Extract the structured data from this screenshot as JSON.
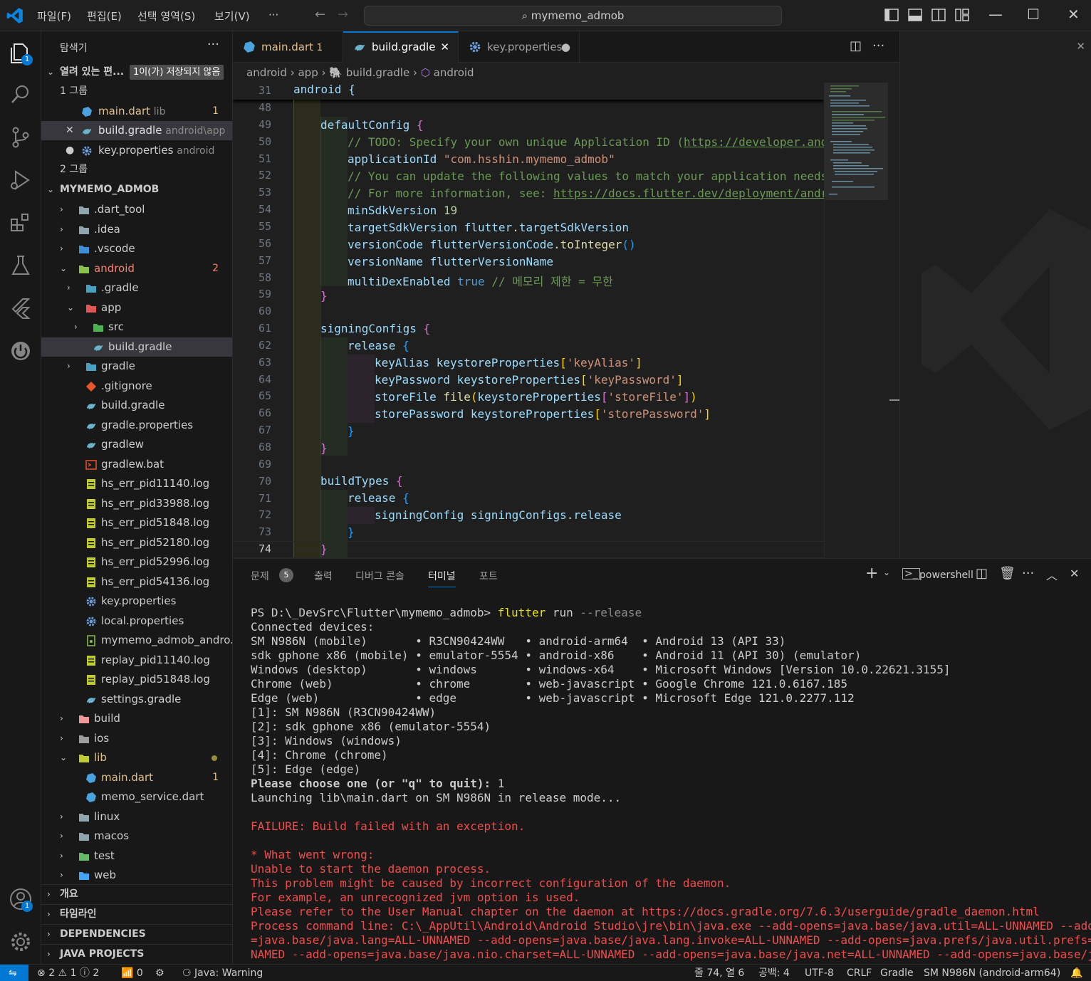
{
  "titlebar": {
    "menus": [
      "파일(F)",
      "편집(E)",
      "선택 영역(S)",
      "보기(V)",
      "···"
    ],
    "search": "mymemo_admob"
  },
  "activity": {
    "explorer_badge": "1",
    "account_badge": "1"
  },
  "sidebar": {
    "title": "탐색기",
    "open_editors_label": "열려 있는 편...",
    "unsaved_badge": "1이(가) 저장되지 않음",
    "group1": "1 그룹",
    "group2": "2 그룹",
    "open_files": [
      {
        "name": "main.dart",
        "desc": "lib",
        "count": "1"
      },
      {
        "name": "build.gradle",
        "desc": "android\\app"
      },
      {
        "name": "key.properties",
        "desc": "android"
      }
    ],
    "project": "MYMEMO_ADMOB",
    "tree": [
      {
        "label": ".dart_tool"
      },
      {
        "label": ".idea"
      },
      {
        "label": ".vscode"
      },
      {
        "label": "android",
        "count": "2"
      },
      {
        "label": ".gradle"
      },
      {
        "label": "app"
      },
      {
        "label": "src"
      },
      {
        "label": "build.gradle"
      },
      {
        "label": "gradle"
      },
      {
        "label": ".gitignore"
      },
      {
        "label": "build.gradle"
      },
      {
        "label": "gradle.properties"
      },
      {
        "label": "gradlew"
      },
      {
        "label": "gradlew.bat"
      },
      {
        "label": "hs_err_pid11140.log"
      },
      {
        "label": "hs_err_pid33988.log"
      },
      {
        "label": "hs_err_pid51848.log"
      },
      {
        "label": "hs_err_pid52180.log"
      },
      {
        "label": "hs_err_pid52996.log"
      },
      {
        "label": "hs_err_pid54136.log"
      },
      {
        "label": "key.properties"
      },
      {
        "label": "local.properties"
      },
      {
        "label": "mymemo_admob_andro..."
      },
      {
        "label": "replay_pid11140.log"
      },
      {
        "label": "replay_pid51848.log"
      },
      {
        "label": "settings.gradle"
      },
      {
        "label": "build"
      },
      {
        "label": "ios"
      },
      {
        "label": "lib"
      },
      {
        "label": "main.dart",
        "count": "1"
      },
      {
        "label": "memo_service.dart"
      },
      {
        "label": "linux"
      },
      {
        "label": "macos"
      },
      {
        "label": "test"
      },
      {
        "label": "web"
      }
    ],
    "sections": [
      "개요",
      "타임라인",
      "DEPENDENCIES",
      "JAVA PROJECTS"
    ]
  },
  "tabs": [
    {
      "label": "main.dart",
      "count": "1"
    },
    {
      "label": "build.gradle"
    },
    {
      "label": "key.properties"
    }
  ],
  "breadcrumb": [
    "android",
    "app",
    "build.gradle",
    "android"
  ],
  "editor": {
    "sticky": {
      "line": "31",
      "text": "android {"
    },
    "line_numbers": [
      "48",
      "49",
      "50",
      "51",
      "52",
      "53",
      "54",
      "55",
      "56",
      "57",
      "58",
      "59",
      "60",
      "61",
      "62",
      "63",
      "64",
      "65",
      "66",
      "67",
      "68",
      "69",
      "70",
      "71",
      "72",
      "73",
      "74"
    ],
    "lines": {
      "l49a": "defaultConfig",
      "l50": "// TODO: Specify your own unique Application ID (",
      "l50link": "https://developer.and",
      "l51a": "applicationId",
      "l51b": "\"com.hsshin.mymemo_admob\"",
      "l52": "// You can update the following values to match your application needs",
      "l53": "// For more information, see: ",
      "l53link": "https://docs.flutter.dev/deployment/andr",
      "l54a": "minSdkVersion",
      "l54b": "19",
      "l55a": "targetSdkVersion",
      "l55b": "flutter",
      "l55c": "targetSdkVersion",
      "l56a": "versionCode",
      "l56b": "flutterVersionCode",
      "l56c": "toInteger",
      "l57a": "versionName",
      "l57b": "flutterVersionName",
      "l58a": "multiDexEnabled",
      "l58b": "true",
      "l58c": "// 메모리 제한 = 무한",
      "l61a": "signingConfigs",
      "l62a": "release",
      "l63a": "keyAlias",
      "l63b": "keystoreProperties",
      "l63c": "'keyAlias'",
      "l64a": "keyPassword",
      "l64b": "keystoreProperties",
      "l64c": "'keyPassword'",
      "l65a": "storeFile",
      "l65b": "file",
      "l65c": "keystoreProperties",
      "l65d": "'storeFile'",
      "l66a": "storePassword",
      "l66b": "keystoreProperties",
      "l66c": "'storePassword'",
      "l70a": "buildTypes",
      "l71a": "release",
      "l72a": "signingConfig",
      "l72b": "signingConfigs",
      "l72c": "release"
    }
  },
  "panel": {
    "tabs": [
      "문제",
      "출력",
      "디버그 콘솔",
      "터미널",
      "포트"
    ],
    "problems_count": "5",
    "shell": "powershell",
    "terminal": {
      "prompt": "PS D:\\_DevSrc\\Flutter\\mymemo_admob> ",
      "cmd": "flutter",
      "cmd_arg1": " run",
      "cmd_arg2": " --release",
      "lines": [
        "Connected devices:",
        "SM N986N (mobile)       • R3CN90424WW   • android-arm64  • Android 13 (API 33)",
        "sdk gphone x86 (mobile) • emulator-5554 • android-x86    • Android 11 (API 30) (emulator)",
        "Windows (desktop)       • windows       • windows-x64    • Microsoft Windows [Version 10.0.22621.3155]",
        "Chrome (web)            • chrome        • web-javascript • Google Chrome 121.0.6167.185",
        "Edge (web)              • edge          • web-javascript • Microsoft Edge 121.0.2277.112",
        "[1]: SM N986N (R3CN90424WW)",
        "[2]: sdk gphone x86 (emulator-5554)",
        "[3]: Windows (windows)",
        "[4]: Chrome (chrome)",
        "[5]: Edge (edge)"
      ],
      "choose_prompt": "Please choose one (or \"q\" to quit): ",
      "choose_value": "1",
      "launching": "Launching lib\\main.dart on SM N986N in release mode...",
      "errors": [
        "FAILURE: Build failed with an exception.",
        "",
        "* What went wrong:",
        "Unable to start the daemon process.",
        "This problem might be caused by incorrect configuration of the daemon.",
        "For example, an unrecognized jvm option is used.",
        "Please refer to the User Manual chapter on the daemon at https://docs.gradle.org/7.6.3/userguide/gradle_daemon.html",
        "Process command line: C:\\_AppUtil\\Android\\Android Studio\\jre\\bin\\java.exe --add-opens=java.base/java.util=ALL-UNNAMED --add-opens",
        "=java.base/java.lang=ALL-UNNAMED --add-opens=java.base/java.lang.invoke=ALL-UNNAMED --add-opens=java.prefs/java.util.prefs=ALL-UN",
        "NAMED --add-opens=java.base/java.nio.charset=ALL-UNNAMED --add-opens=java.base/java.net=ALL-UNNAMED --add-opens=java.base/java.ut"
      ]
    }
  },
  "statusbar": {
    "errors": "2",
    "warnings": "1",
    "infos": "2",
    "ports": "0",
    "java": "Java: Warning",
    "position": "줄 74, 열 6",
    "spaces": "공백: 4",
    "encoding": "UTF-8",
    "eol": "CRLF",
    "language": "Gradle",
    "device": "SM N986N (android-arm64)"
  },
  "colors": {
    "accent": "#0078d4",
    "error": "#f14c4c",
    "modified": "#e2c08d"
  }
}
